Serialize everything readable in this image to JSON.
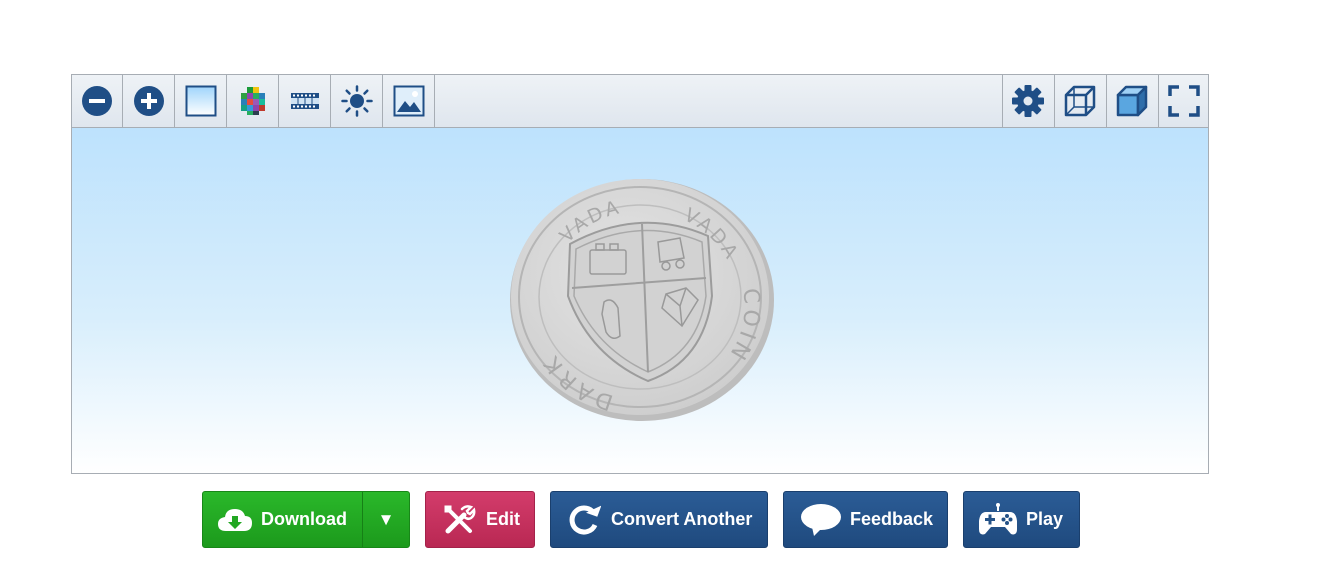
{
  "toolbar": {
    "left_tools": [
      "zoom-out",
      "zoom-in",
      "background",
      "color",
      "film",
      "lighting",
      "image"
    ],
    "right_tools": [
      "settings",
      "wireframe",
      "solid",
      "fullscreen"
    ],
    "icon_color": "#1f4e86"
  },
  "model": {
    "coin_text_top": "VADA",
    "coin_text_left": "VADA",
    "coin_text_right": "COIN",
    "coin_text_bottom": "DARK"
  },
  "buttons": {
    "download": "Download",
    "download_caret": "▼",
    "edit": "Edit",
    "convert": "Convert Another",
    "feedback": "Feedback",
    "play": "Play"
  },
  "colors": {
    "download": "#22a722",
    "edit": "#c73260",
    "primary": "#245287"
  }
}
